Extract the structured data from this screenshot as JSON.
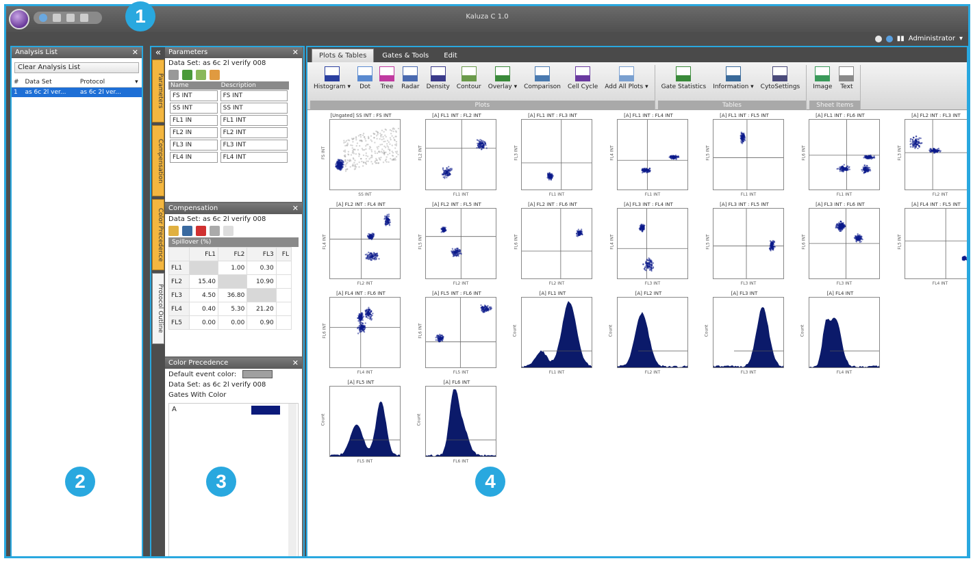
{
  "titlebar": {
    "title": "Kaluza C 1.0"
  },
  "user": {
    "name": "Administrator"
  },
  "callouts": [
    "1",
    "2",
    "3",
    "4"
  ],
  "analysis_list": {
    "title": "Analysis List",
    "clear_label": "Clear Analysis List",
    "columns": [
      "#",
      "Data Set",
      "Protocol"
    ],
    "rows": [
      {
        "num": "1",
        "dataset": "as 6c 2l ver...",
        "protocol": "as 6c 2l ver..."
      }
    ]
  },
  "side_tabs": [
    "Parameters",
    "Compensation",
    "Color Precedence",
    "Protocol Outline"
  ],
  "parameters": {
    "title": "Parameters",
    "dataset": "Data Set: as 6c 2l verify 008",
    "columns": [
      "Name",
      "Description"
    ],
    "rows": [
      {
        "name": "FS INT",
        "desc": "FS INT"
      },
      {
        "name": "SS INT",
        "desc": "SS INT"
      },
      {
        "name": "FL1 IN",
        "desc": "FL1 INT"
      },
      {
        "name": "FL2 IN",
        "desc": "FL2 INT"
      },
      {
        "name": "FL3 IN",
        "desc": "FL3 INT"
      },
      {
        "name": "FL4 IN",
        "desc": "FL4 INT"
      }
    ]
  },
  "compensation": {
    "title": "Compensation",
    "dataset": "Data Set: as 6c 2l verify 008",
    "matrix_label": "Spillover (%)",
    "columns": [
      "FL1",
      "FL2",
      "FL3",
      "FL"
    ],
    "rows": [
      {
        "label": "FL1",
        "cells": [
          "",
          "1.00",
          "0.30"
        ]
      },
      {
        "label": "FL2",
        "cells": [
          "15.40",
          "",
          "10.90"
        ]
      },
      {
        "label": "FL3",
        "cells": [
          "4.50",
          "36.80",
          ""
        ]
      },
      {
        "label": "FL4",
        "cells": [
          "0.40",
          "5.30",
          "21.20"
        ]
      },
      {
        "label": "FL5",
        "cells": [
          "0.00",
          "0.00",
          "0.90"
        ]
      }
    ]
  },
  "color_precedence": {
    "title": "Color Precedence",
    "default_label": "Default event color:",
    "dataset": "Data Set: as 6c 2l verify 008",
    "gates_label": "Gates With Color",
    "gates": [
      {
        "name": "A",
        "color": "#0b1a7a"
      }
    ]
  },
  "main_tabs": [
    "Plots & Tables",
    "Gates & Tools",
    "Edit"
  ],
  "ribbon": {
    "groups": [
      {
        "label": "Plots",
        "buttons": [
          "Histogram ▾",
          "Dot",
          "Tree",
          "Radar",
          "Density",
          "Contour",
          "Overlay ▾",
          "Comparison",
          "Cell Cycle",
          "Add All Plots ▾"
        ]
      },
      {
        "label": "Tables",
        "buttons": [
          "Gate Statistics",
          "Information ▾",
          "CytoSettings"
        ]
      },
      {
        "label": "Sheet Items",
        "buttons": [
          "Image",
          "Text"
        ]
      }
    ]
  },
  "plots": [
    {
      "title": "[Ungated] SS INT : FS INT",
      "xlabel": "SS INT",
      "ylabel": "FS INT",
      "kind": "scatter"
    },
    {
      "title": "[A] FL1 INT : FL2 INT",
      "xlabel": "FL1 INT",
      "ylabel": "FL2 INT",
      "kind": "quad"
    },
    {
      "title": "[A] FL1 INT : FL3 INT",
      "xlabel": "FL1 INT",
      "ylabel": "FL3 INT",
      "kind": "quad"
    },
    {
      "title": "[A] FL1 INT : FL4 INT",
      "xlabel": "FL1 INT",
      "ylabel": "FL4 INT",
      "kind": "quad"
    },
    {
      "title": "[A] FL1 INT : FL5 INT",
      "xlabel": "FL1 INT",
      "ylabel": "FL5 INT",
      "kind": "quad"
    },
    {
      "title": "[A] FL1 INT : FL6 INT",
      "xlabel": "FL1 INT",
      "ylabel": "FL6 INT",
      "kind": "quad"
    },
    {
      "title": "[A] FL2 INT : FL3 INT",
      "xlabel": "FL2 INT",
      "ylabel": "FL3 INT",
      "kind": "quad"
    },
    {
      "title": "[A] FL2 INT : FL4 INT",
      "xlabel": "FL2 INT",
      "ylabel": "FL4 INT",
      "kind": "quad"
    },
    {
      "title": "[A] FL2 INT : FL5 INT",
      "xlabel": "FL2 INT",
      "ylabel": "FL5 INT",
      "kind": "quad"
    },
    {
      "title": "[A] FL2 INT : FL6 INT",
      "xlabel": "FL2 INT",
      "ylabel": "FL6 INT",
      "kind": "quad"
    },
    {
      "title": "[A] FL3 INT : FL4 INT",
      "xlabel": "FL3 INT",
      "ylabel": "FL4 INT",
      "kind": "quad"
    },
    {
      "title": "[A] FL3 INT : FL5 INT",
      "xlabel": "FL3 INT",
      "ylabel": "FL5 INT",
      "kind": "quad"
    },
    {
      "title": "[A] FL3 INT : FL6 INT",
      "xlabel": "FL3 INT",
      "ylabel": "FL6 INT",
      "kind": "quad"
    },
    {
      "title": "[A] FL4 INT : FL5 INT",
      "xlabel": "FL4 INT",
      "ylabel": "FL5 INT",
      "kind": "quad"
    },
    {
      "title": "[A] FL4 INT : FL6 INT",
      "xlabel": "FL4 INT",
      "ylabel": "FL6 INT",
      "kind": "quad"
    },
    {
      "title": "[A] FL5 INT : FL6 INT",
      "xlabel": "FL5 INT",
      "ylabel": "FL6 INT",
      "kind": "quad"
    },
    {
      "title": "[A] FL1 INT",
      "xlabel": "FL1 INT",
      "ylabel": "Count",
      "kind": "hist"
    },
    {
      "title": "[A] FL2 INT",
      "xlabel": "FL2 INT",
      "ylabel": "Count",
      "kind": "hist"
    },
    {
      "title": "[A] FL3 INT",
      "xlabel": "FL3 INT",
      "ylabel": "Count",
      "kind": "hist"
    },
    {
      "title": "[A] FL4 INT",
      "xlabel": "FL4 INT",
      "ylabel": "Count",
      "kind": "hist"
    },
    {
      "title": "[A] FL5 INT",
      "xlabel": "FL5 INT",
      "ylabel": "Count",
      "kind": "hist"
    },
    {
      "title": "[A] FL6 INT",
      "xlabel": "FL6 INT",
      "ylabel": "Count",
      "kind": "hist"
    }
  ]
}
